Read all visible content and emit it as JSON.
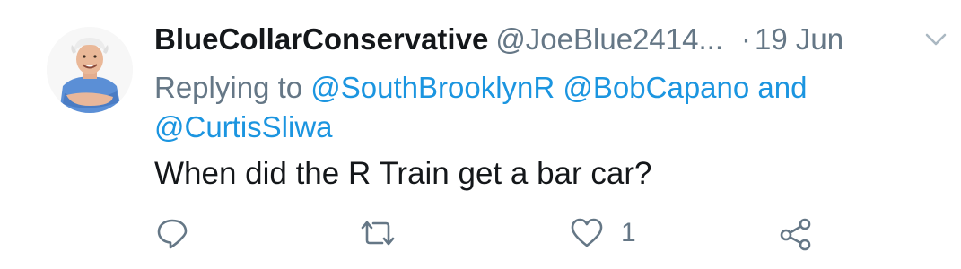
{
  "tweet": {
    "display_name": "BlueCollarConservative",
    "handle": "@JoeBlue2414...",
    "separator": "·",
    "date": "19 Jun",
    "replying_to_prefix": "Replying to",
    "mentions": [
      "@SouthBrooklynR",
      "@BobCapano",
      "@CurtisSliwa"
    ],
    "mentions_conjunction": "and",
    "text": "When did the R Train get a bar car?",
    "actions": {
      "reply_icon": "reply-bubble-icon",
      "retweet_icon": "retweet-icon",
      "like_icon": "heart-icon",
      "like_count": "1",
      "share_icon": "share-icon"
    },
    "menu_icon": "chevron-down-icon"
  },
  "colors": {
    "text_primary": "#14171a",
    "text_secondary": "#657786",
    "link": "#1b95e0",
    "icon": "#657786"
  }
}
